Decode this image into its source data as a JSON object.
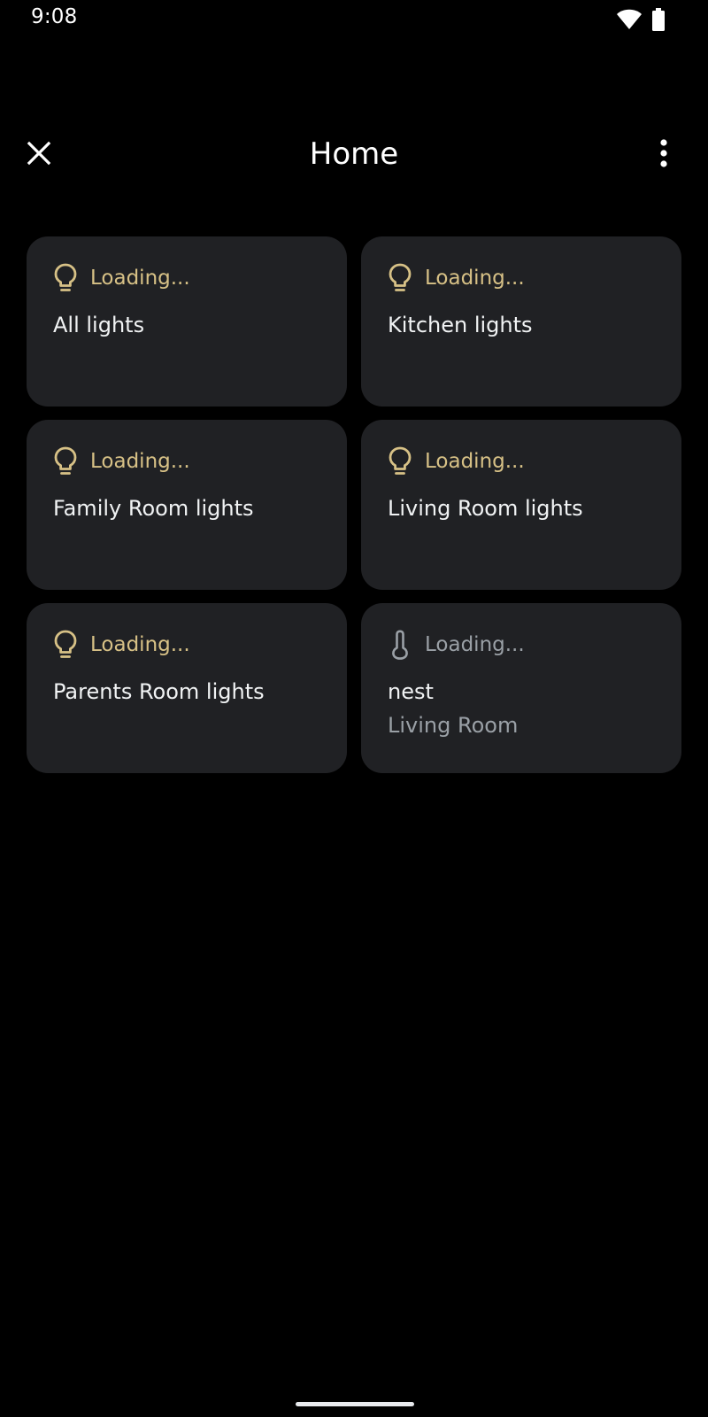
{
  "status_bar": {
    "time": "9:08",
    "icons": [
      "wifi-icon",
      "battery-icon"
    ]
  },
  "header": {
    "title": "Home",
    "close_icon": "close-icon",
    "more_icon": "more-vertical-icon"
  },
  "tiles": [
    {
      "status": "Loading...",
      "name": "All lights",
      "icon": "lightbulb-icon"
    },
    {
      "status": "Loading...",
      "name": "Kitchen lights",
      "icon": "lightbulb-icon"
    },
    {
      "status": "Loading...",
      "name": "Family Room lights",
      "icon": "lightbulb-icon"
    },
    {
      "status": "Loading...",
      "name": "Living Room lights",
      "icon": "lightbulb-icon"
    },
    {
      "status": "Loading...",
      "name": "Parents Room lights",
      "icon": "lightbulb-icon"
    },
    {
      "status": "Loading...",
      "name": "nest",
      "subtitle": "Living Room",
      "icon": "thermometer-icon"
    }
  ],
  "colors": {
    "background": "#000000",
    "tile_background": "#202124",
    "light_accent": "#d7c186",
    "muted_text": "#9aa0a6",
    "primary_text": "#f1f3f4"
  }
}
